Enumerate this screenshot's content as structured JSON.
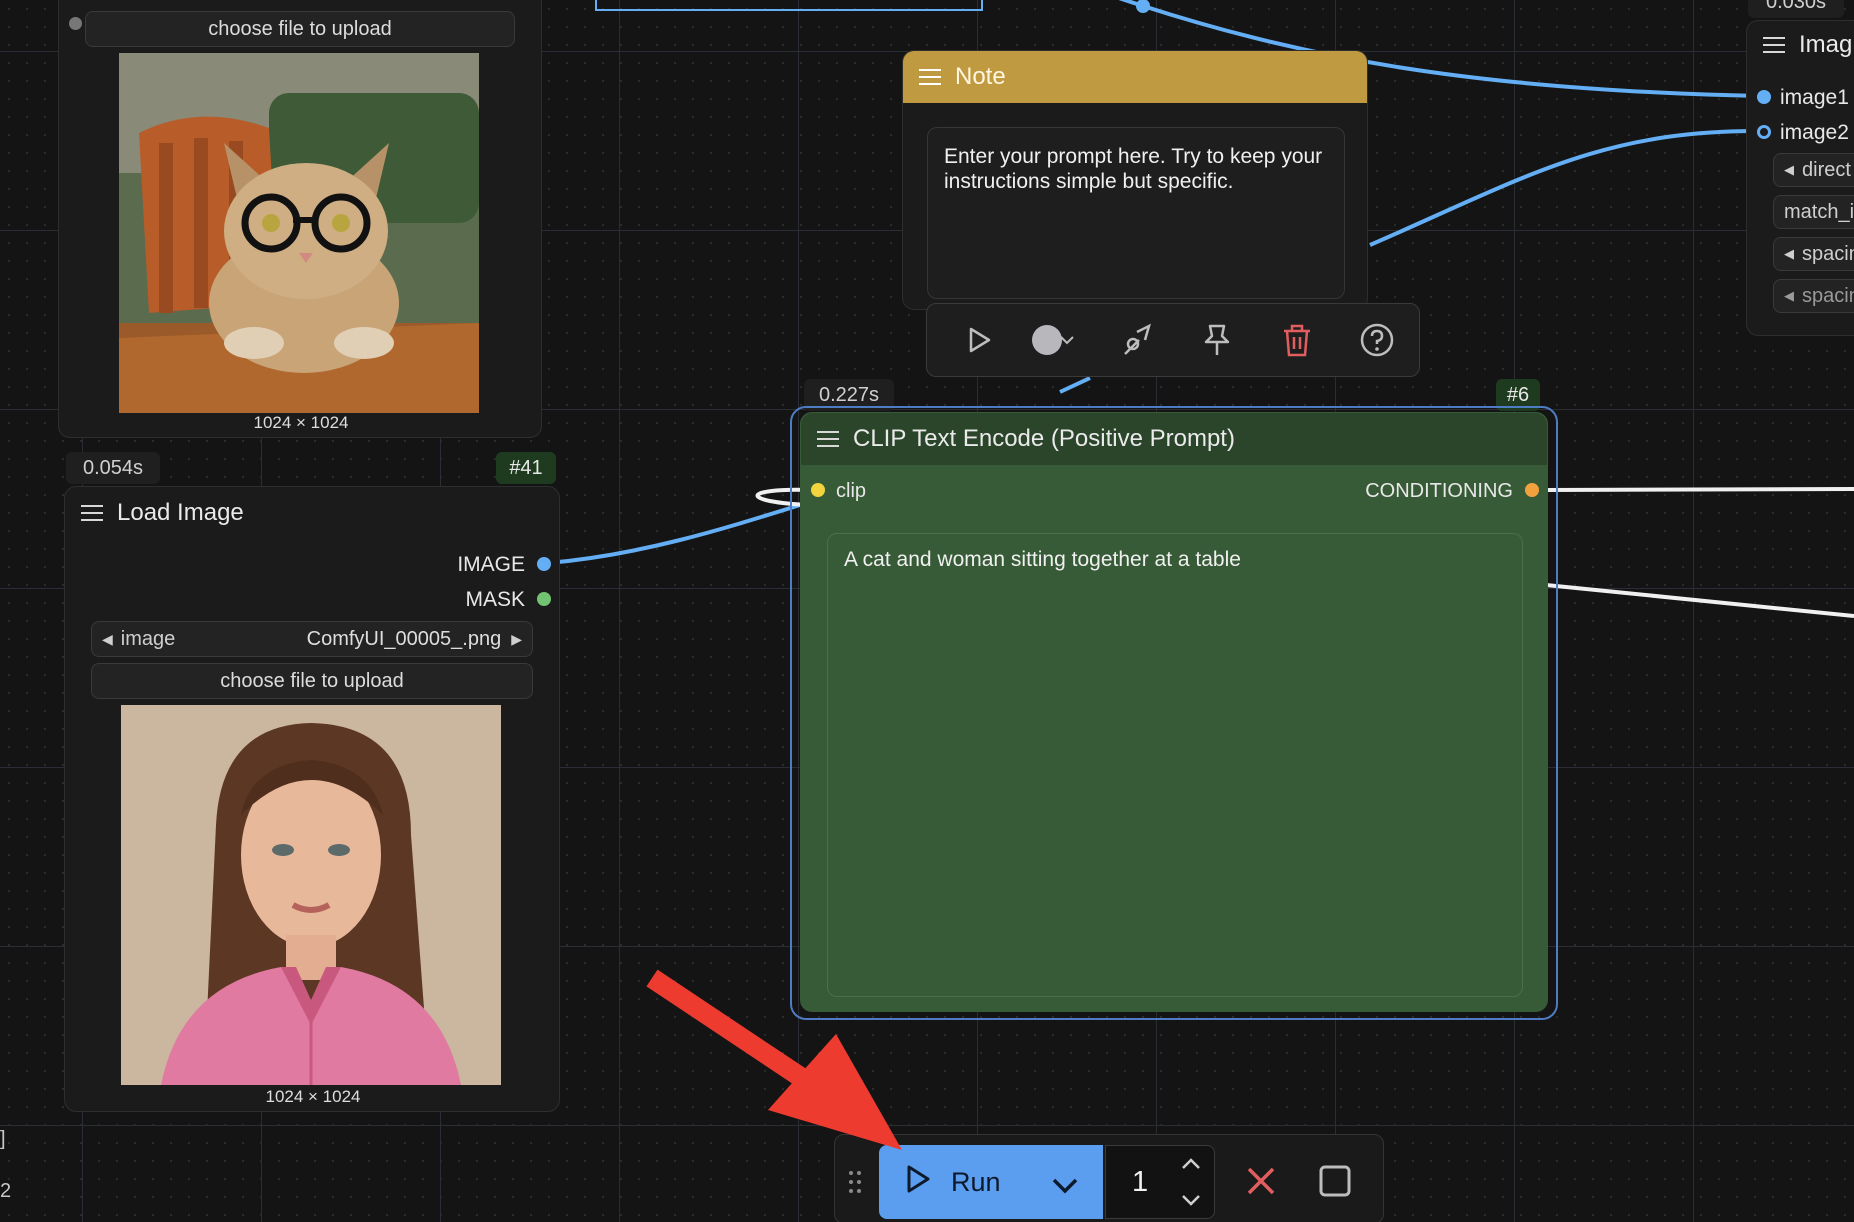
{
  "colors": {
    "note_header": "#c09a40",
    "clip_node": "#375a37",
    "run_button": "#5b9ef0",
    "link_blue": "#64aef5",
    "link_white": "#f0f0f0",
    "annotation_arrow": "#ee3b30",
    "danger": "#e25d5d"
  },
  "top_load_image": {
    "upload_label": "choose file to upload",
    "preview_icon": "cat-with-glasses-image",
    "caption": "1024 × 1024"
  },
  "load_image": {
    "time_badge": "0.054s",
    "id_badge": "#41",
    "title": "Load Image",
    "outputs": [
      "IMAGE",
      "MASK"
    ],
    "combo_label": "image",
    "combo_value": "ComfyUI_00005_.png",
    "upload_label": "choose file to upload",
    "preview_icon": "woman-portrait-image",
    "caption": "1024 × 1024"
  },
  "note": {
    "title": "Note",
    "text": "Enter your prompt here.  Try to keep your instructions simple but specific."
  },
  "selection_toolbar": {
    "icons": [
      "play-icon",
      "color-circle-icon",
      "chevron-down-icon",
      "bypass-icon",
      "pin-icon",
      "trash-icon",
      "help-icon"
    ]
  },
  "clip_node": {
    "time_badge": "0.227s",
    "id_badge": "#6",
    "title": "CLIP Text Encode (Positive Prompt)",
    "input": "clip",
    "output": "CONDITIONING",
    "prompt": "A cat and woman sitting together at a table"
  },
  "right_node": {
    "time_badge": "0.030s",
    "title": "Imag",
    "inputs": [
      "image1",
      "image2"
    ],
    "widgets": [
      "direct",
      "match_i",
      "spacin",
      "spacin"
    ]
  },
  "left_edge_text": [
    "]",
    "2"
  ],
  "run_toolbar": {
    "run_label": "Run",
    "batch_count": "1"
  }
}
